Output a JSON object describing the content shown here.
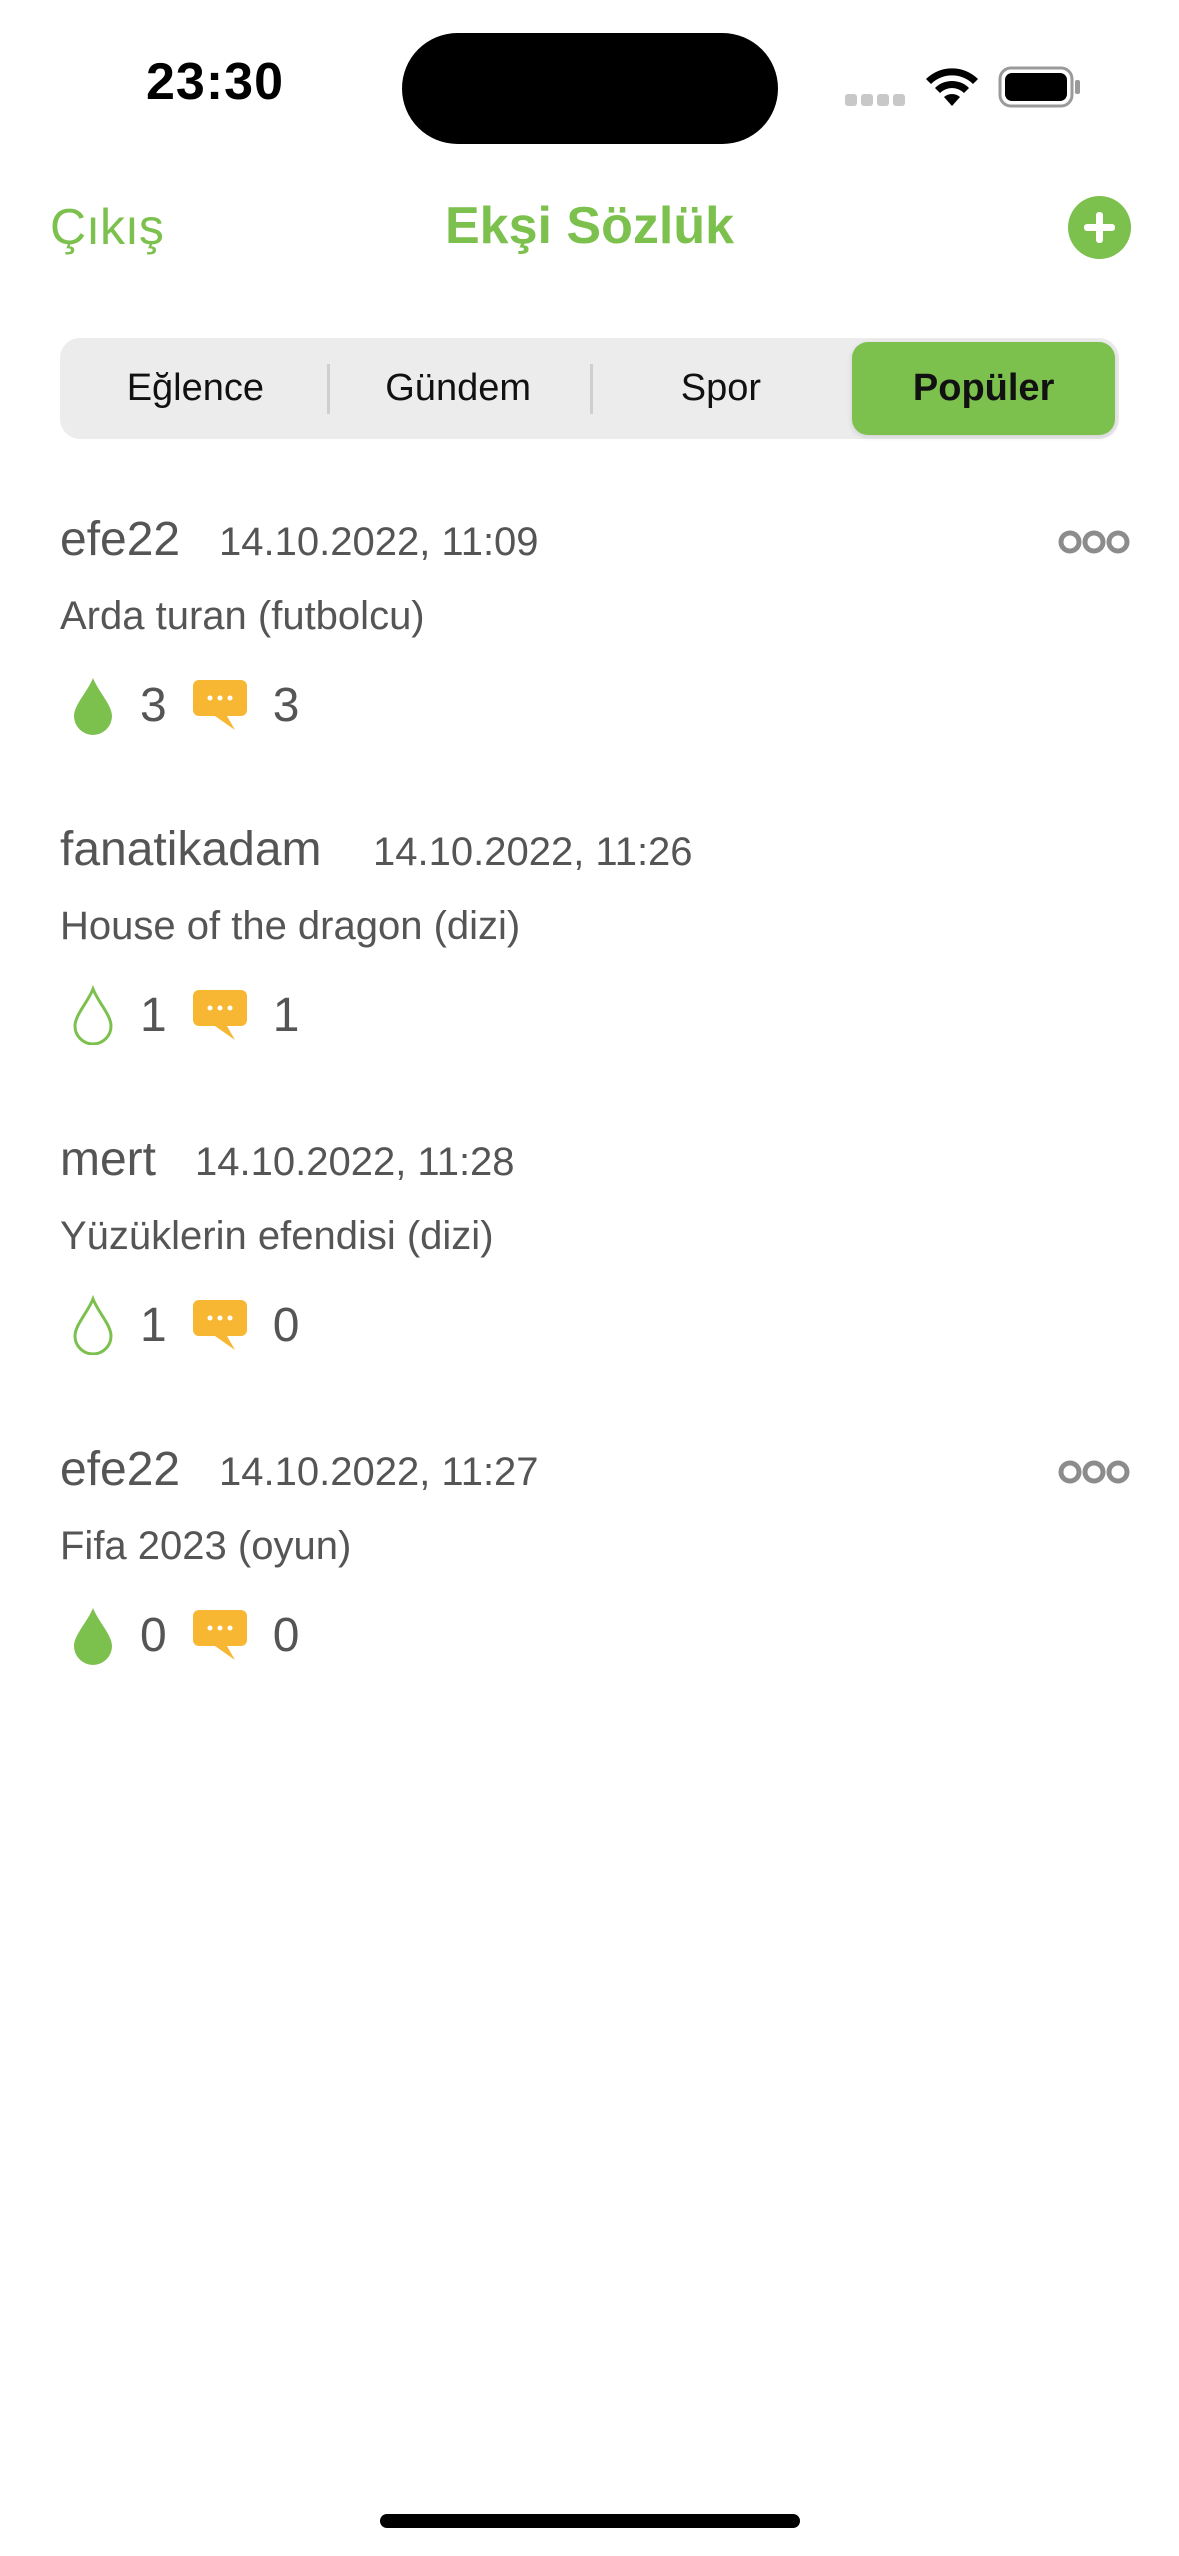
{
  "status_bar": {
    "time": "23:30"
  },
  "nav": {
    "left_label": "Çıkış",
    "title": "Ekşi Sözlük"
  },
  "tabs": [
    {
      "label": "Eğlence"
    },
    {
      "label": "Gündem"
    },
    {
      "label": "Spor"
    },
    {
      "label": "Popüler",
      "selected": true
    }
  ],
  "posts": [
    {
      "user": "efe22",
      "date": "14.10.2022, 11:09",
      "title": "Arda turan (futbolcu)",
      "likes": "3",
      "comments": "3",
      "liked": true,
      "has_menu": true
    },
    {
      "user": "fanatikadam",
      "date": "14.10.2022, 11:26",
      "title": "House of the dragon (dizi)",
      "likes": "1",
      "comments": "1",
      "liked": false,
      "has_menu": false
    },
    {
      "user": "mert",
      "date": "14.10.2022, 11:28",
      "title": "Yüzüklerin efendisi (dizi)",
      "likes": "1",
      "comments": "0",
      "liked": false,
      "has_menu": false
    },
    {
      "user": "efe22",
      "date": "14.10.2022, 11:27",
      "title": "Fifa 2023 (oyun)",
      "likes": "0",
      "comments": "0",
      "liked": true,
      "has_menu": true
    }
  ],
  "colors": {
    "accent": "#7cc04e",
    "comment": "#f7b733",
    "text": "#555555"
  },
  "icons": {
    "like": "drop-icon",
    "comment": "speech-bubble-icon",
    "more": "more-icon",
    "add": "plus-circle-icon"
  }
}
